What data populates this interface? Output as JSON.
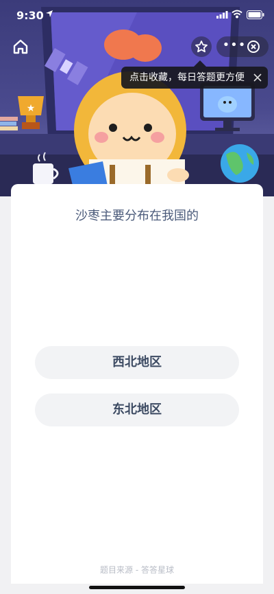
{
  "status_bar": {
    "time": "9:30"
  },
  "nav": {
    "tooltip": "点击收藏，每日答题更方便",
    "more_label": "•••"
  },
  "quiz": {
    "question": "沙枣主要分布在我国的",
    "options": [
      "西北地区",
      "东北地区"
    ],
    "source": "题目来源 - 答答星球"
  },
  "colors": {
    "banner": "#4a4a8e",
    "card": "#ffffff",
    "question_text": "#4a5a7a",
    "option_bg": "#f2f3f5"
  }
}
